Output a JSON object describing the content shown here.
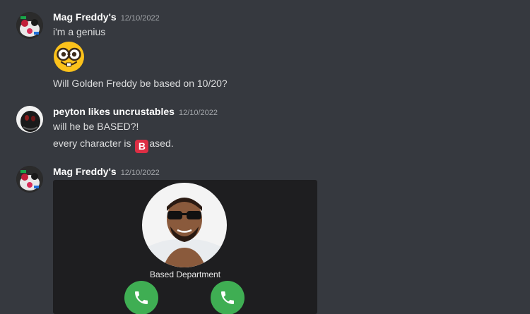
{
  "messages": [
    {
      "username": "Mag Freddy's",
      "timestamp": "12/10/2022",
      "lines": [
        "i'm a genius",
        "Will Golden Freddy be based on 10/20?"
      ],
      "emoji": "nerd-face"
    },
    {
      "username": "peyton likes uncrustables",
      "timestamp": "12/10/2022",
      "lines": [
        "will he be BASED?!",
        "every character is ",
        "ased."
      ],
      "inline_emoji": "B"
    },
    {
      "username": "Mag Freddy's",
      "timestamp": "12/10/2022",
      "embed": {
        "caller_name": "Based Department",
        "buttons": [
          "phone-icon",
          "phone-icon"
        ]
      }
    }
  ],
  "colors": {
    "background": "#36393f",
    "accept_green": "#3fae53",
    "b_emoji": "#dd2e44"
  }
}
